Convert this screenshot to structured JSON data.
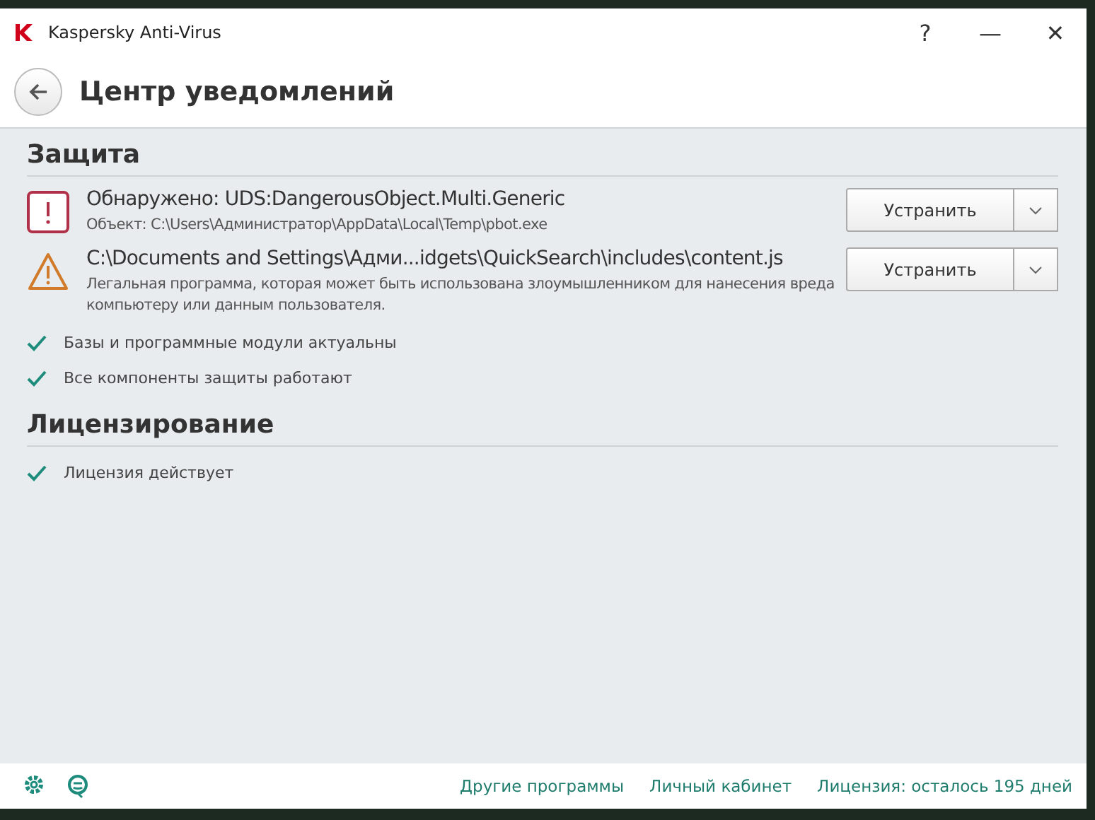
{
  "window": {
    "title": "Kaspersky Anti-Virus",
    "controls": [
      "?",
      "—",
      "✕"
    ]
  },
  "header": {
    "title": "Центр уведомлений"
  },
  "sections": [
    {
      "title": "Защита",
      "alerts": [
        {
          "kind": "danger",
          "title": "Обнаружено: UDS:DangerousObject.Multi.Generic",
          "detail": "Объект: C:\\Users\\Администратор\\AppData\\Local\\Temp\\pbot.exe",
          "button": "Устранить"
        },
        {
          "kind": "warning",
          "title": "C:\\Documents and Settings\\Адми...idgets\\QuickSearch\\includes\\content.js",
          "detail": "Легальная программа, которая может быть использована злоумышленником для нанесения вреда компьютеру или данным пользователя.",
          "button": "Устранить"
        }
      ],
      "statuses": [
        {
          "text": "Базы и программные модули актуальны"
        },
        {
          "text": "Все компоненты защиты работают"
        }
      ]
    },
    {
      "title": "Лицензирование",
      "statuses": [
        {
          "text": "Лицензия действует"
        }
      ]
    }
  ],
  "footer": {
    "links": [
      "Другие программы",
      "Личный кабинет",
      "Лицензия: осталось 195 дней"
    ]
  }
}
